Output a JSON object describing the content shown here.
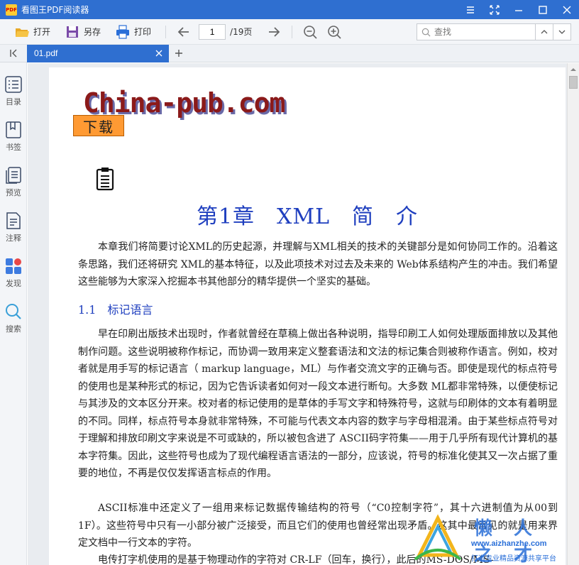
{
  "app": {
    "title": "看图王PDF阅读器",
    "logo_text": "PDF"
  },
  "toolbar": {
    "open_label": "打开",
    "save_as_label": "另存",
    "print_label": "打印",
    "page_current": "1",
    "page_total": "/19页",
    "search_placeholder": "查找"
  },
  "tabs": [
    {
      "label": "01.pdf",
      "active": true
    }
  ],
  "sidebar": {
    "items": [
      {
        "label": "目录",
        "icon": "toc-icon"
      },
      {
        "label": "书签",
        "icon": "bookmark-icon"
      },
      {
        "label": "预览",
        "icon": "preview-icon"
      },
      {
        "label": "注释",
        "icon": "annotation-icon"
      },
      {
        "label": "发现",
        "icon": "discover-icon"
      },
      {
        "label": "搜索",
        "icon": "search-icon"
      }
    ]
  },
  "document": {
    "logo": "China-pub.com",
    "download_badge": "下载",
    "chapter_title": "第1章　XML　简　介",
    "intro": "本章我们将简要讨论XML的历史起源，并理解与XML相关的技术的关键部分是如何协同工作的。沿着这条思路，我们还将研究 XML的基本特征，以及此项技术对过去及未来的 Web体系结构产生的冲击。我们希望这些能够为大家深入挖掘本书其他部分的精华提供一个坚实的基础。",
    "section_heading": "1.1　标记语言",
    "para1": "早在印刷出版技术出现时，作者就曾经在草稿上做出各种说明，指导印刷工人如何处理版面排放以及其他制作问题。这些说明被称作标记，而协调一致用来定义整套语法和文法的标记集合则被称作语言。例如，校对者就是用手写的标记语言（ markup language，ML）与作者交流文字的正确与否。即使是现代的标点符号的使用也是某种形式的标记，因为它告诉读者如何对一段文本进行断句。大多数 ML都非常特殊，以便使标记与其涉及的文本区分开来。校对者的标记使用的是草体的手写文字和特殊符号，这就与印刷体的文本有着明显的不同。同样，标点符号本身就非常特殊，不可能与代表文本内容的数字与字母相混淆。由于某些标点符号对于理解和排放印刷文字来说是不可或缺的，所以被包含进了 ASCII码字符集——用于几乎所有现代计算机的基本字符集。因此，这些符号也成为了现代编程语言语法的一部分，应该说，符号的标准化使其又一次占据了重要的地位，不再是仅仅发挥语言标点的作用。",
    "para2": "ASCII标准中还定义了一组用来标记数据传输结构的符号（“C0控制字符”，其十六进制值为从00到1F）。这些符号中只有一小部分被广泛接受，而且它们的使用也曾经常出现矛盾。这其中最常见的就是用来界定文档中一行文本的字符。",
    "para3": "电传打字机使用的是基于物理动作的字符对 CR-LF（回车，换行），此后的MS-DOS/MS-"
  },
  "watermark": {
    "chars": "懒人之才",
    "url": "www.aizhanzhe.com",
    "sub": "打造专业精品资源共享平台"
  },
  "colors": {
    "titlebar": "#2f6fd0",
    "heading": "#1f3fbf",
    "badge": "#ff9a33"
  }
}
